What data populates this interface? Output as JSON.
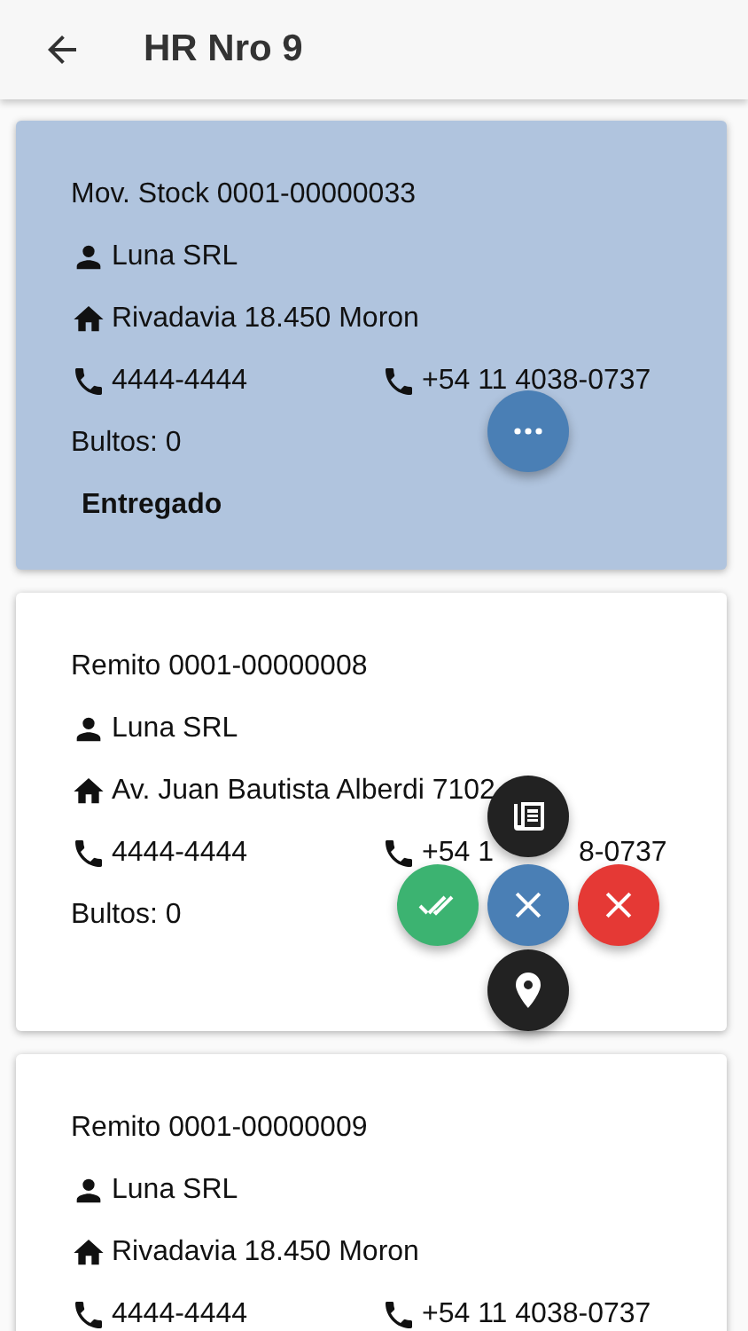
{
  "app_bar": {
    "title": "HR Nro 9"
  },
  "cards": [
    {
      "selected": true,
      "document": "Mov. Stock 0001-00000033",
      "client": "Luna SRL",
      "address": "Rivadavia 18.450 Moron",
      "phone1": "4444-4444",
      "phone2_parts": [
        "+54 11 4038-0737"
      ],
      "packages": "Bultos: 0",
      "status": "Entregado",
      "menu_open": false
    },
    {
      "selected": false,
      "document": "Remito 0001-00000008",
      "client": "Luna SRL",
      "address": "Av. Juan Bautista Alberdi 7102",
      "phone1": "4444-4444",
      "phone2_parts": [
        "+54 1",
        "8-0737"
      ],
      "packages": "Bultos: 0",
      "menu_open": true
    },
    {
      "selected": false,
      "document": "Remito 0001-00000009",
      "client": "Luna SRL",
      "address": "Rivadavia 18.450 Moron",
      "phone1": "4444-4444",
      "phone2_parts": [
        "+54 11 4038-0737"
      ]
    }
  ]
}
